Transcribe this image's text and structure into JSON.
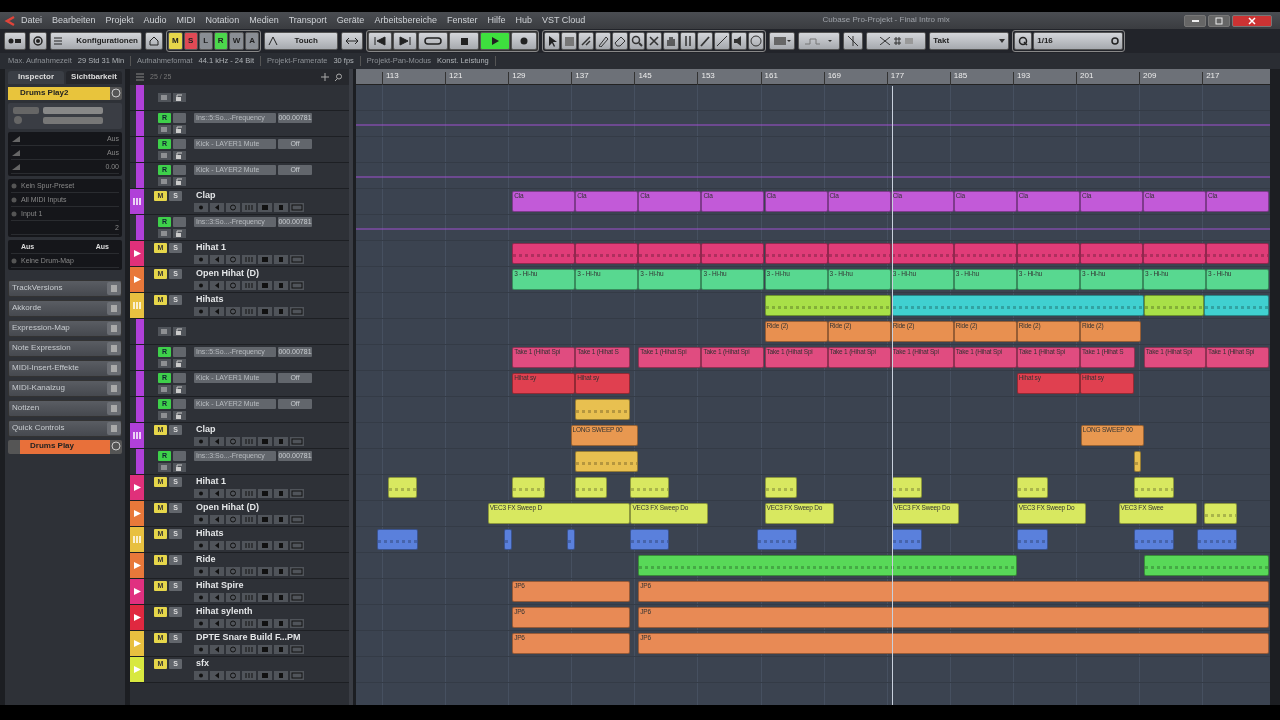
{
  "window": {
    "title": "Cubase Pro-Projekt - Final Intro mix"
  },
  "menu": [
    "Datei",
    "Bearbeiten",
    "Projekt",
    "Audio",
    "MIDI",
    "Notation",
    "Medien",
    "Transport",
    "Geräte",
    "Arbeitsbereiche",
    "Fenster",
    "Hilfe",
    "Hub",
    "VST Cloud"
  ],
  "toolbar": {
    "configurations": "Konfigurationen",
    "modes": [
      {
        "label": "M",
        "color": "#e6d64a"
      },
      {
        "label": "S",
        "color": "#e04a55"
      },
      {
        "label": "L",
        "color": "#8a8e94"
      },
      {
        "label": "R",
        "color": "#4cd84c"
      },
      {
        "label": "W",
        "color": "#8a8e94"
      },
      {
        "label": "A",
        "color": "#8a8e94"
      }
    ],
    "automation_mode": "Touch",
    "playing": true,
    "snap_type": "Takt",
    "quantize": "1/16"
  },
  "info_bar": [
    {
      "label": "Max. Aufnahmezeit",
      "value": "29 Std 31 Min"
    },
    {
      "label": "Aufnahmeformat",
      "value": "44.1 kHz - 24 Bit"
    },
    {
      "label": "Projekt-Framerate",
      "value": "30 fps"
    },
    {
      "label": "Projekt-Pan-Modus",
      "value": "Konst. Leistung"
    }
  ],
  "inspector": {
    "tabs": [
      {
        "label": "Inspector",
        "selected": true
      },
      {
        "label": "Sichtbarkeit",
        "selected": false
      }
    ],
    "track_name": "Drums Play2",
    "values": [
      "Aus",
      "Aus",
      "0.00"
    ],
    "routing": [
      "Kein Spur-Preset",
      "All MIDI Inputs",
      "Input 1"
    ],
    "channel": "2",
    "drum_settings": [
      "Aus",
      "Aus"
    ],
    "drum_map": "Keine Drum-Map",
    "sections": [
      "TrackVersions",
      "Akkorde",
      "Expression-Map",
      "Note Expression",
      "MIDI-Insert-Effekte",
      "MIDI-Kanalzug",
      "Notizen",
      "Quick Controls"
    ],
    "footer_track": "Drums Play"
  },
  "track_list": {
    "count": "25 / 25",
    "rows": [
      {
        "kind": "automation_tools",
        "color": "#b040d8"
      },
      {
        "kind": "automation",
        "color": "#b040d8",
        "parameter": "Ins::5:So...-Frequency",
        "value": "000.00781",
        "read": "R"
      },
      {
        "kind": "automation",
        "color": "#b040d8",
        "parameter": "Kick - LAYER1 Mute",
        "value": "Off",
        "read": "R"
      },
      {
        "kind": "automation",
        "color": "#b040d8",
        "parameter": "Kick - LAYER2 Mute",
        "value": "Off",
        "read": "R"
      },
      {
        "kind": "instrument",
        "color": "#b040d8",
        "name": "Clap",
        "mute": "M",
        "solo": "S"
      },
      {
        "kind": "automation",
        "color": "#b040d8",
        "parameter": "Ins::3:So...-Frequency",
        "value": "000.00781",
        "read": "R"
      },
      {
        "kind": "midi",
        "color": "#e0307a",
        "name": "Hihat 1",
        "mute": "M",
        "solo": "S"
      },
      {
        "kind": "midi",
        "color": "#e8783a",
        "name": "Open Hihat (D)",
        "mute": "M",
        "solo": "S"
      },
      {
        "kind": "instrument",
        "color": "#e8c040",
        "name": "Hihats",
        "mute": "M",
        "solo": "S"
      },
      {
        "kind": "automation_tools",
        "color": "#b040d8"
      },
      {
        "kind": "automation",
        "color": "#b040d8",
        "parameter": "Ins::5:So...-Frequency",
        "value": "000.00781",
        "read": "R"
      },
      {
        "kind": "automation",
        "color": "#b040d8",
        "parameter": "Kick - LAYER1 Mute",
        "value": "Off",
        "read": "R"
      },
      {
        "kind": "automation",
        "color": "#b040d8",
        "parameter": "Kick - LAYER2 Mute",
        "value": "Off",
        "read": "R"
      },
      {
        "kind": "instrument",
        "color": "#b040d8",
        "name": "Clap",
        "mute": "M",
        "solo": "S"
      },
      {
        "kind": "automation",
        "color": "#b040d8",
        "parameter": "Ins::3:So...-Frequency",
        "value": "000.00781",
        "read": "R"
      },
      {
        "kind": "midi",
        "color": "#e0307a",
        "name": "Hihat 1",
        "mute": "M",
        "solo": "S"
      },
      {
        "kind": "midi",
        "color": "#e8783a",
        "name": "Open Hihat (D)",
        "mute": "M",
        "solo": "S"
      },
      {
        "kind": "instrument",
        "color": "#e8c040",
        "name": "Hihats",
        "mute": "M",
        "solo": "S"
      },
      {
        "kind": "midi",
        "color": "#e8783a",
        "name": "Ride",
        "mute": "M",
        "solo": "S"
      },
      {
        "kind": "midi",
        "color": "#e03080",
        "name": "Hihat Spire",
        "mute": "M",
        "solo": "S"
      },
      {
        "kind": "midi",
        "color": "#e02840",
        "name": "Hihat sylenth",
        "mute": "M",
        "solo": "S"
      },
      {
        "kind": "midi",
        "color": "#e8c040",
        "name": "DPTE Snare Build F...PM",
        "mute": "M",
        "solo": "S"
      },
      {
        "kind": "midi",
        "color": "#d8e840",
        "name": "sfx",
        "mute": "M",
        "solo": "S"
      }
    ]
  },
  "arrange": {
    "ruler": [
      "113",
      "121",
      "129",
      "137",
      "145",
      "153",
      "161",
      "169",
      "177",
      "185",
      "193",
      "201",
      "209",
      "217"
    ],
    "lanes": [
      {
        "kind": "empty"
      },
      {
        "kind": "automation"
      },
      {
        "kind": "empty"
      },
      {
        "kind": "automation"
      },
      {
        "kind": "parts",
        "color": "#c25ad8",
        "parts": [
          {
            "label": "Cla"
          },
          {
            "label": "Cla"
          },
          {
            "label": "Cla"
          },
          {
            "label": "Cla"
          },
          {
            "label": "Cla"
          },
          {
            "label": "Cla"
          },
          {
            "label": "Cla"
          },
          {
            "label": "Cla"
          },
          {
            "label": "Cla"
          },
          {
            "label": "Cla"
          },
          {
            "label": "Cla"
          },
          {
            "label": "Cla"
          }
        ]
      },
      {
        "kind": "automation"
      },
      {
        "kind": "parts",
        "color": "#e03c78",
        "parts": [
          {
            "kind": "block"
          },
          {
            "kind": "block"
          },
          {
            "kind": "block"
          },
          {
            "kind": "block"
          },
          {
            "kind": "block"
          },
          {
            "kind": "block"
          },
          {
            "kind": "block"
          },
          {
            "kind": "block"
          },
          {
            "kind": "block"
          },
          {
            "kind": "block"
          },
          {
            "kind": "block"
          },
          {
            "kind": "block"
          }
        ]
      },
      {
        "kind": "parts",
        "color": "#58d890",
        "parts": [
          {
            "label": "3 - Hi-hu"
          },
          {
            "label": "3 - Hi-hu"
          },
          {
            "label": "3 - Hi-hu"
          },
          {
            "label": "3 - Hi-hu"
          },
          {
            "label": "3 - Hi-hu"
          },
          {
            "label": "3 - Hi-hu"
          },
          {
            "label": "3 - Hi-hu"
          },
          {
            "label": "3 - Hi-hu"
          },
          {
            "label": "3 - Hi-hu"
          },
          {
            "label": "3 - Hi-hu"
          },
          {
            "label": "3 - Hi-hu"
          },
          {
            "label": "3 - Hi-hu"
          }
        ]
      },
      {
        "kind": "parts",
        "color": "#a8e048",
        "parts": [
          {
            "kind": "block"
          },
          {
            "kind": "block",
            "color": "#40d0d0"
          },
          {
            "kind": "block"
          },
          {
            "kind": "block",
            "color": "#40d0d0"
          }
        ]
      },
      {
        "kind": "parts",
        "color": "#e89050",
        "parts": [
          {
            "label": "Ride (2)"
          },
          {
            "label": "Ride (2)"
          },
          {
            "label": "Ride (2)"
          },
          {
            "label": "Ride (2)"
          },
          {
            "label": "Ride (2)"
          },
          {
            "label": "Ride (2)"
          }
        ]
      },
      {
        "kind": "parts",
        "color": "#e04c80",
        "parts": [
          {
            "label": "Take 1 (Hihat Spi"
          },
          {
            "label": "Take 1 (Hihat S"
          },
          {
            "label": "Take 1 (Hihat Spi"
          },
          {
            "label": "Take 1 (Hihat Spi"
          },
          {
            "label": "Take 1 (Hihat Spi"
          },
          {
            "label": "Take 1 (Hihat Spi"
          },
          {
            "label": "Take 1 (Hihat Spi"
          },
          {
            "label": "Take 1 (Hihat Spi"
          },
          {
            "label": "Take 1 (Hihat Spi"
          },
          {
            "label": "Take 1 (Hihat S"
          },
          {
            "label": "Take 1 (Hihat Spi"
          },
          {
            "label": "Take 1 (Hihat Spi"
          }
        ]
      },
      {
        "kind": "parts",
        "color": "#e04050",
        "parts": [
          {
            "label": "Hihat sy"
          },
          {
            "label": "Hihat sy"
          },
          {
            "label": "Hihat sy"
          },
          {
            "label": "Hihat sy"
          }
        ]
      },
      {
        "kind": "parts",
        "color": "#e8c050",
        "parts": [
          {
            "kind": "block"
          }
        ]
      },
      {
        "kind": "parts",
        "color": "#e89850",
        "parts": [
          {
            "label": "LONG SWEEP 00"
          },
          {
            "label": "LONG SWEEP 00"
          }
        ]
      },
      {
        "kind": "parts",
        "color": "#e8c050",
        "parts": [
          {
            "kind": "block"
          },
          {
            "kind": "block"
          }
        ]
      },
      {
        "kind": "parts",
        "color": "#d8e860",
        "parts": [
          {
            "kind": "block"
          },
          {
            "kind": "block"
          },
          {
            "kind": "block"
          },
          {
            "kind": "block"
          },
          {
            "kind": "block"
          },
          {
            "kind": "block"
          },
          {
            "kind": "block"
          },
          {
            "kind": "block"
          }
        ]
      },
      {
        "kind": "parts",
        "color": "#d8e860",
        "parts": [
          {
            "label": "VEC3 FX Sweep D"
          },
          {
            "label": "VEC3 FX Sweep Do"
          },
          {
            "label": "VEC3 FX Sweep Do"
          },
          {
            "label": "VEC3 FX Sweep Do"
          },
          {
            "label": "VEC3 FX Sweep Do"
          },
          {
            "label": "VEC3 FX Swee"
          },
          {
            "kind": "block"
          }
        ]
      },
      {
        "kind": "parts",
        "color": "#5a80dc",
        "parts": [
          {
            "kind": "block"
          },
          {
            "kind": "block"
          },
          {
            "kind": "block"
          },
          {
            "kind": "block"
          },
          {
            "kind": "block"
          },
          {
            "kind": "block"
          },
          {
            "kind": "block"
          },
          {
            "kind": "block"
          },
          {
            "kind": "block"
          }
        ]
      },
      {
        "kind": "parts",
        "color": "#58d858",
        "parts": [
          {
            "kind": "block"
          },
          {
            "kind": "block"
          }
        ]
      },
      {
        "kind": "parts",
        "color": "#e88a55",
        "parts": [
          {
            "label": "JP6"
          },
          {
            "label": "JP6"
          }
        ]
      },
      {
        "kind": "parts",
        "color": "#e88a55",
        "parts": [
          {
            "label": "JP6"
          },
          {
            "label": "JP6"
          }
        ]
      },
      {
        "kind": "parts",
        "color": "#e88a55",
        "parts": [
          {
            "label": "JP6"
          },
          {
            "label": "JP6"
          }
        ]
      },
      {
        "kind": "empty"
      }
    ]
  }
}
